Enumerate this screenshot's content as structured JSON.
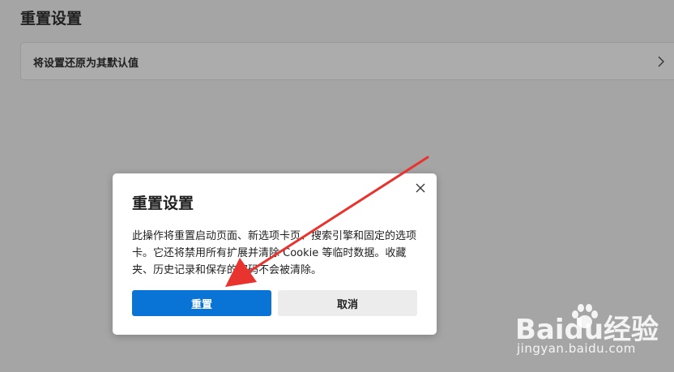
{
  "page": {
    "title": "重置设置"
  },
  "settings_row": {
    "label": "将设置还原为其默认值",
    "icon": "chevron-right-icon"
  },
  "dialog": {
    "title": "重置设置",
    "body": "此操作将重置启动页面、新选项卡页、搜索引擎和固定的选项卡。它还将禁用所有扩展并清除 Cookie 等临时数据。收藏夹、历史记录和保存的密码不会被清除。",
    "close_icon": "close-icon",
    "reset_button": "重置",
    "cancel_button": "取消"
  },
  "annotation": {
    "color": "#e8332e",
    "icon": "arrow-icon"
  },
  "watermark": {
    "text": "Baidu经验",
    "url": "jingyan.baidu.com"
  },
  "colors": {
    "primary_button": "#0a74d6",
    "secondary_button": "#ececec",
    "backdrop": "#a5a5a5"
  }
}
